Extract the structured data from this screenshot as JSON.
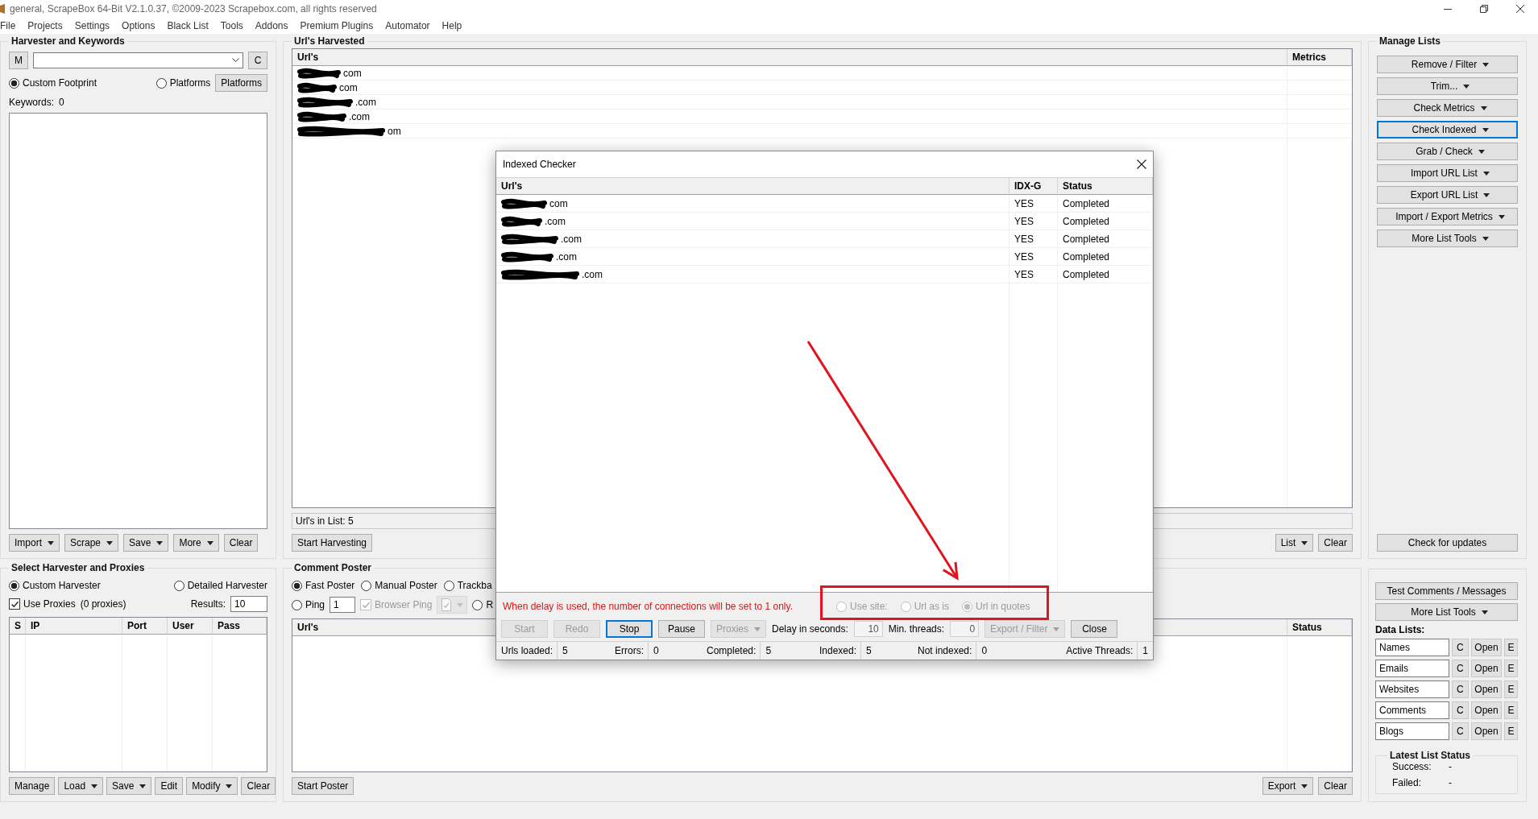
{
  "window": {
    "title": "general, ScrapeBox 64-Bit V2.1.0.37, ©2009-2023 Scrapebox.com, all rights reserved"
  },
  "menu": [
    "File",
    "Projects",
    "Settings",
    "Options",
    "Black List",
    "Tools",
    "Addons",
    "Premium Plugins",
    "Automator",
    "Help"
  ],
  "harvester": {
    "title": "Harvester and Keywords",
    "m_button": "M",
    "c_button": "C",
    "footprint_options": [
      {
        "label": "Custom Footprint",
        "selected": true
      },
      {
        "label": "Platforms",
        "selected": false
      }
    ],
    "platforms_button": "Platforms",
    "keywords_label": "Keywords:",
    "keywords_count": "0",
    "buttons": [
      {
        "label": "Import",
        "dropdown": true
      },
      {
        "label": "Scrape",
        "dropdown": true
      },
      {
        "label": "Save",
        "dropdown": true
      },
      {
        "label": "More",
        "dropdown": true
      },
      {
        "label": "Clear",
        "dropdown": false
      }
    ]
  },
  "urls_harvested": {
    "title": "Url's Harvested",
    "columns": [
      "Url's",
      "Metrics"
    ],
    "rows": [
      {
        "url": "com"
      },
      {
        "url": "com"
      },
      {
        "url": ".com"
      },
      {
        "url": ".com"
      },
      {
        "url": "om"
      }
    ],
    "count": "Url's in List: 5",
    "start_button": "Start Harvesting",
    "buttons": [
      {
        "label": "List",
        "dropdown": true
      },
      {
        "label": "Clear",
        "dropdown": false
      }
    ]
  },
  "manage_lists": {
    "title": "Manage Lists",
    "buttons": [
      {
        "label": "Remove / Filter",
        "focused": false
      },
      {
        "label": "Trim...",
        "focused": false
      },
      {
        "label": "Check Metrics",
        "focused": false
      },
      {
        "label": "Check Indexed",
        "focused": true
      },
      {
        "label": "Grab / Check",
        "focused": false
      },
      {
        "label": "Import URL List",
        "focused": false
      },
      {
        "label": "Export URL List",
        "focused": false
      },
      {
        "label": "Import / Export Metrics",
        "focused": false
      },
      {
        "label": "More List Tools",
        "focused": false
      }
    ],
    "update_button": "Check for updates"
  },
  "proxies": {
    "title": "Select Harvester and Proxies",
    "harvester_options": [
      {
        "label": "Custom Harvester",
        "selected": true
      },
      {
        "label": "Detailed Harvester",
        "selected": false
      }
    ],
    "use_proxies": {
      "label": "Use Proxies",
      "checked": true
    },
    "proxy_count": "(0 proxies)",
    "results_label": "Results:",
    "results_value": "10",
    "columns": [
      "S",
      "IP",
      "Port",
      "User",
      "Pass"
    ],
    "buttons": [
      {
        "label": "Manage",
        "dropdown": false
      },
      {
        "label": "Load",
        "dropdown": true
      },
      {
        "label": "Save",
        "dropdown": true
      },
      {
        "label": "Edit",
        "dropdown": false
      },
      {
        "label": "Modify",
        "dropdown": true
      },
      {
        "label": "Clear",
        "dropdown": false
      }
    ]
  },
  "comment_poster": {
    "title": "Comment Poster",
    "poster_options": [
      {
        "label": "Fast Poster",
        "selected": true
      },
      {
        "label": "Manual Poster",
        "selected": false
      },
      {
        "label": "Trackba",
        "selected": false
      }
    ],
    "ping": {
      "label": "Ping",
      "selected": false
    },
    "ping_value": "1",
    "browser_ping": {
      "label": "Browser Ping",
      "checked": true,
      "disabled": true
    },
    "format_dropdown": {
      "disabled": true
    },
    "last_option": {
      "label": "R",
      "selected": false
    },
    "columns": [
      "Url's",
      "Status"
    ],
    "start_button": "Start Poster",
    "buttons": [
      {
        "label": "Export",
        "dropdown": true
      },
      {
        "label": "Clear",
        "dropdown": false
      }
    ]
  },
  "poster_tools": {
    "test_button": "Test Comments / Messages",
    "more_button": "More List Tools",
    "data_lists_title": "Data Lists:",
    "data_lists": [
      {
        "name": "Names",
        "c": "C",
        "open": "Open",
        "e": "E"
      },
      {
        "name": "Emails",
        "c": "C",
        "open": "Open",
        "e": "E"
      },
      {
        "name": "Websites",
        "c": "C",
        "open": "Open",
        "e": "E"
      },
      {
        "name": "Comments",
        "c": "C",
        "open": "Open",
        "e": "E"
      },
      {
        "name": "Blogs",
        "c": "C",
        "open": "Open",
        "e": "E"
      }
    ],
    "latest_status": {
      "title": "Latest List Status",
      "rows": [
        {
          "label": "Success:",
          "value": "-"
        },
        {
          "label": "Failed:",
          "value": "-"
        }
      ]
    }
  },
  "dialog": {
    "title": "Indexed Checker",
    "columns": [
      "Url's",
      "IDX-G",
      "Status"
    ],
    "rows": [
      {
        "url": "com",
        "indexed": "YES",
        "status": "Completed"
      },
      {
        "url": ".com",
        "indexed": "YES",
        "status": "Completed"
      },
      {
        "url": ".com",
        "indexed": "YES",
        "status": "Completed"
      },
      {
        "url": ".com",
        "indexed": "YES",
        "status": "Completed"
      },
      {
        "url": ".com",
        "indexed": "YES",
        "status": "Completed"
      }
    ],
    "warning": "When delay is used, the number of connections will be set to 1 only.",
    "url_modes": [
      {
        "label": "Use site:",
        "selected": false,
        "disabled": true
      },
      {
        "label": "Url as is",
        "selected": false,
        "disabled": true
      },
      {
        "label": "Url in quotes",
        "selected": true,
        "disabled": true
      }
    ],
    "controls": [
      {
        "kind": "button",
        "label": "Start",
        "disabled": true,
        "focused": false
      },
      {
        "kind": "button",
        "label": "Redo",
        "disabled": true,
        "focused": false
      },
      {
        "kind": "button",
        "label": "Stop",
        "disabled": false,
        "focused": true
      },
      {
        "kind": "button",
        "label": "Pause",
        "disabled": false,
        "focused": false
      },
      {
        "kind": "dropdown",
        "label": "Proxies",
        "disabled": true,
        "focused": false
      },
      {
        "kind": "field",
        "label": "Delay in seconds:",
        "value": "10",
        "disabled": true
      },
      {
        "kind": "field",
        "label": "Min. threads:",
        "value": "0",
        "disabled": true
      },
      {
        "kind": "dropdown",
        "label": "Export / Filter",
        "disabled": true,
        "focused": false
      },
      {
        "kind": "button",
        "label": "Close",
        "disabled": false,
        "focused": false
      }
    ],
    "stats": [
      {
        "label": "Urls loaded:",
        "value": "5"
      },
      {
        "label": "Errors:",
        "value": "0"
      },
      {
        "label": "Completed:",
        "value": "5"
      },
      {
        "label": "Indexed:",
        "value": "5"
      },
      {
        "label": "Not indexed:",
        "value": "0"
      },
      {
        "label": "Active Threads:",
        "value": "1"
      }
    ]
  }
}
